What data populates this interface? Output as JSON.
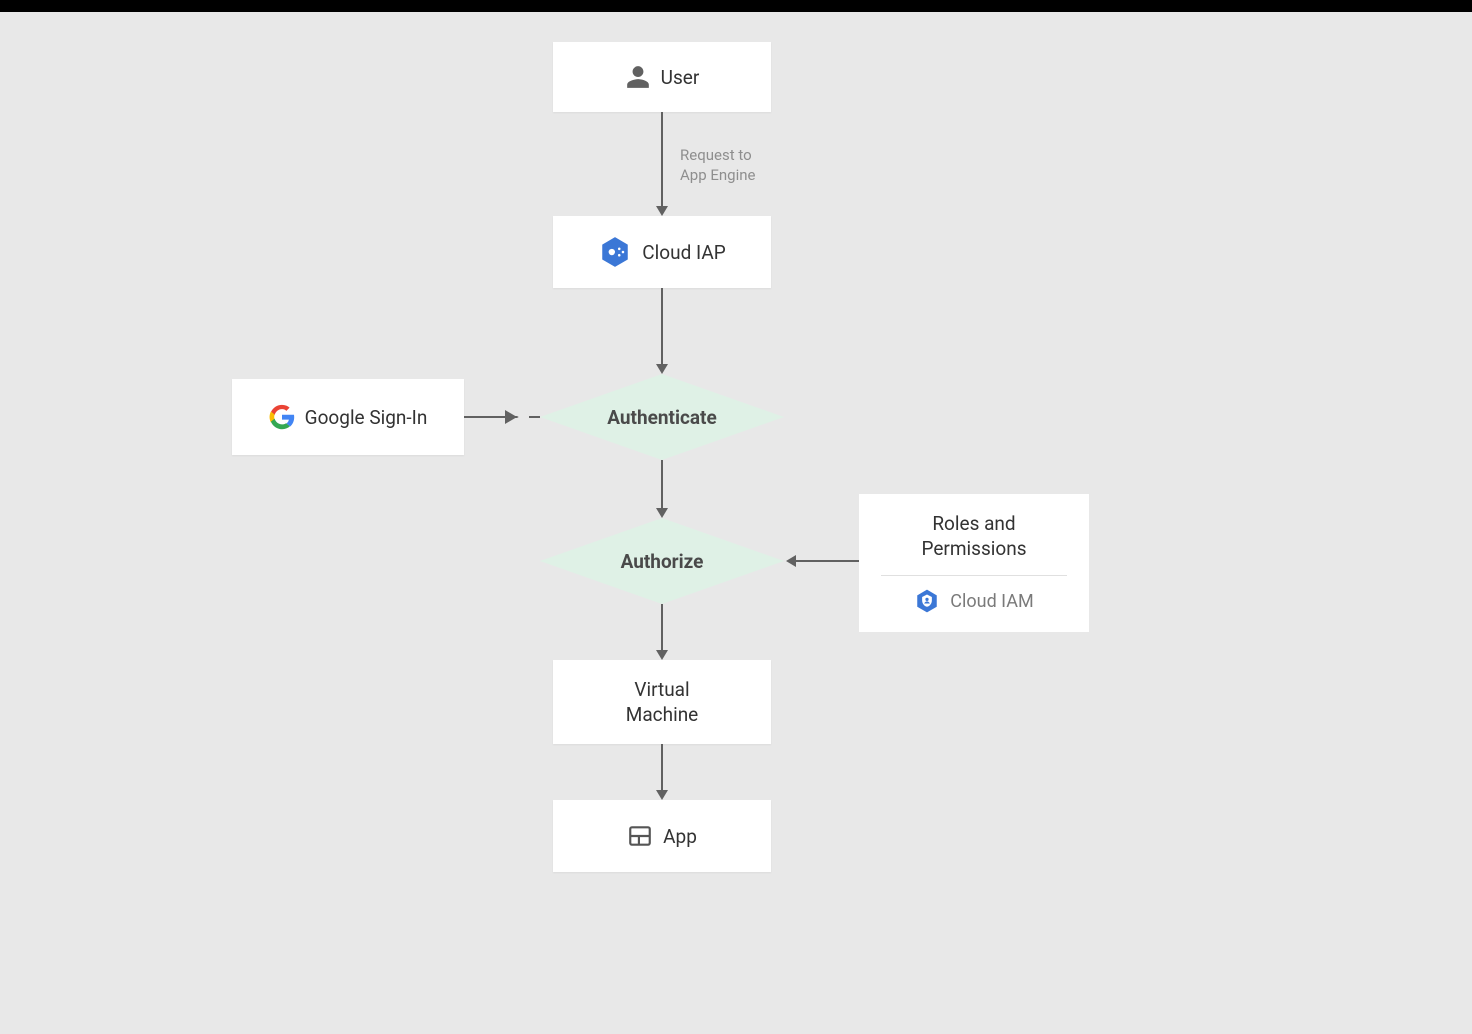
{
  "nodes": {
    "user": {
      "label": "User"
    },
    "cloud_iap": {
      "label": "Cloud IAP"
    },
    "google_signin": {
      "label": "Google Sign-In"
    },
    "authenticate": {
      "label": "Authenticate"
    },
    "authorize": {
      "label": "Authorize"
    },
    "roles": {
      "title_l1": "Roles and",
      "title_l2": "Permissions",
      "sub": "Cloud IAM"
    },
    "vm": {
      "label_l1": "Virtual",
      "label_l2": "Machine"
    },
    "app": {
      "label": "App"
    }
  },
  "edges": {
    "user_to_iap": {
      "label_l1": "Request to",
      "label_l2": "App Engine"
    }
  },
  "colors": {
    "diamond_bg": "#dff1e6",
    "arrow": "#616161",
    "page_bg": "#e8e8e8"
  }
}
